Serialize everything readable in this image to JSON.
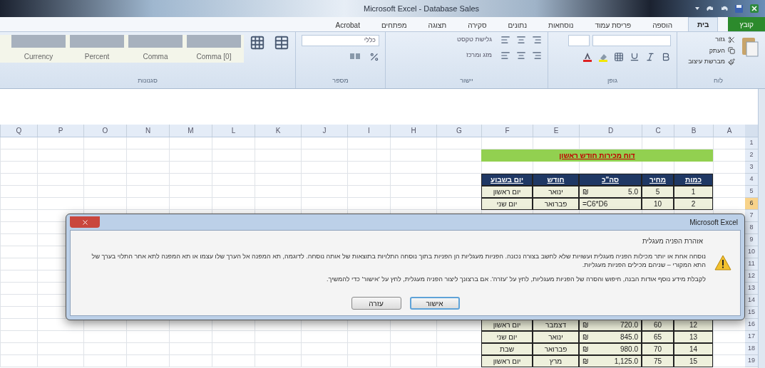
{
  "window": {
    "title": "Microsoft Excel - Database Sales"
  },
  "ribbon_tabs": [
    {
      "label": "קובץ",
      "kind": "file",
      "selected": false
    },
    {
      "label": "בית",
      "kind": "tab",
      "selected": true
    },
    {
      "label": "הוספה",
      "kind": "tab",
      "selected": false
    },
    {
      "label": "פריסת עמוד",
      "kind": "tab",
      "selected": false
    },
    {
      "label": "נוסחאות",
      "kind": "tab",
      "selected": false
    },
    {
      "label": "נתונים",
      "kind": "tab",
      "selected": false
    },
    {
      "label": "סקירה",
      "kind": "tab",
      "selected": false
    },
    {
      "label": "תצוגה",
      "kind": "tab",
      "selected": false
    },
    {
      "label": "מפתחים",
      "kind": "tab",
      "selected": false
    },
    {
      "label": "Acrobat",
      "kind": "tab",
      "selected": false
    }
  ],
  "ribbon": {
    "clipboard": {
      "label": "לוח",
      "items": [
        "גזור",
        "העתק",
        "מברשת עיצוב"
      ]
    },
    "font": {
      "label": "גופן"
    },
    "alignment": {
      "label": "יישור",
      "items": [
        "גלישת טקסט",
        "מזג ומרכז"
      ]
    },
    "number": {
      "label": "מספר",
      "format": "כללי"
    },
    "styles": {
      "label": "סגנונות",
      "cell_styles": [
        "Comma [0]",
        "Comma",
        "Percent",
        "Currency"
      ]
    }
  },
  "sheet": {
    "columns": [
      "A",
      "B",
      "C",
      "D",
      "E",
      "F",
      "G",
      "H",
      "I",
      "J",
      "K",
      "L",
      "M",
      "N",
      "O",
      "P",
      "Q"
    ],
    "row_headers": [
      {
        "label": "1",
        "selected": false
      },
      {
        "label": "2",
        "selected": false
      },
      {
        "label": "3",
        "selected": false
      },
      {
        "label": "4",
        "selected": false
      },
      {
        "label": "5",
        "selected": false
      },
      {
        "label": "6",
        "selected": true
      },
      {
        "label": "7",
        "selected": false
      },
      {
        "label": "8",
        "selected": false
      },
      {
        "label": "9",
        "selected": false
      },
      {
        "label": "10",
        "selected": false
      },
      {
        "label": "11",
        "selected": false
      },
      {
        "label": "12",
        "selected": false
      },
      {
        "label": "13",
        "selected": false
      },
      {
        "label": "14",
        "selected": false
      },
      {
        "label": "15",
        "selected": false
      },
      {
        "label": "16",
        "selected": false
      },
      {
        "label": "17",
        "selected": false
      },
      {
        "label": "18",
        "selected": false
      },
      {
        "label": "19",
        "selected": false
      }
    ],
    "banner": "דוח מכירות חודש ראשון",
    "table": {
      "headers": [
        "כמות",
        "מחיר",
        "סה\"כ",
        "חודש",
        "יום בשבוע"
      ],
      "rows_above_dialog": [
        {
          "quantity": "1",
          "price": "5",
          "currency": "₪",
          "total": "5.0",
          "month": "ינואר",
          "day": "יום ראשון"
        },
        {
          "quantity": "2",
          "price": "10",
          "formula": "=C6*D6",
          "month": "פברואר",
          "day": "יום שני"
        }
      ],
      "rows_below_dialog": [
        {
          "quantity": "12",
          "price": "60",
          "currency": "₪",
          "total": "720.0",
          "month": "דצמבר",
          "day": "יום ראשון"
        },
        {
          "quantity": "13",
          "price": "65",
          "currency": "₪",
          "total": "845.0",
          "month": "ינואר",
          "day": "יום שני"
        },
        {
          "quantity": "14",
          "price": "70",
          "currency": "₪",
          "total": "980.0",
          "month": "פברואר",
          "day": "שבת"
        },
        {
          "quantity": "15",
          "price": "75",
          "currency": "₪",
          "total": "1,125.0",
          "month": "מרץ",
          "day": "יום ראשון"
        }
      ]
    }
  },
  "dialog": {
    "title": "Microsoft Excel",
    "heading": "אזהרת הפניה מעגלית",
    "paragraphs": [
      "נוסחה אחת או יותר מכילות הפניה מעגלית ועשויות שלא לחשב בצורה נכונה. הפניות מעגליות הן הפניות בתוך נוסחה התלויות בתוצאות של אותה נוסחה. לדוגמה, תא המפנה אל הערך שלו עצמו או תא המפנה לתא אחר התלוי בערך של התא המקורי – שניהם מכילים הפניות מעגליות.",
      "לקבלת מידע נוסף אודות הבנה, חיפוש והסרה של הפניות מעגליות, לחץ על 'עזרה'. אם ברצונך ליצור הפניה מעגלית, לחץ על 'אישור' כדי להמשיך."
    ],
    "buttons": [
      {
        "label": "אישור",
        "kind": "default"
      },
      {
        "label": "עזרה",
        "kind": "normal"
      }
    ]
  }
}
